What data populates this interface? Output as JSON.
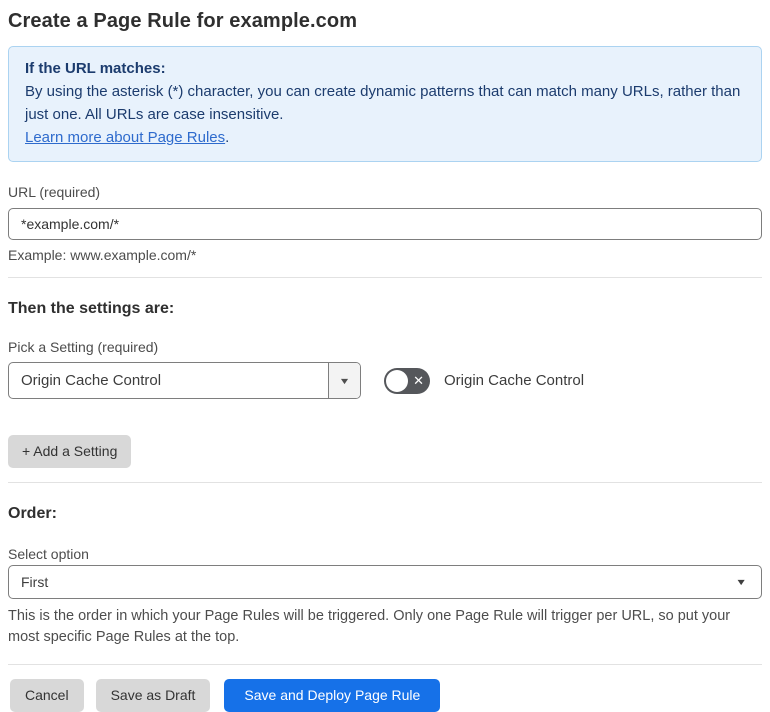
{
  "page": {
    "title": "Create a Page Rule for example.com"
  },
  "info_box": {
    "heading": "If the URL matches:",
    "body": "By using the asterisk (*) character, you can create dynamic patterns that can match many URLs, rather than just one. All URLs are case insensitive.",
    "link_label": "Learn more about Page Rules",
    "link_suffix": "."
  },
  "url_section": {
    "label": "URL (required)",
    "value": "*example.com/*",
    "helper": "Example: www.example.com/*"
  },
  "settings_section": {
    "heading": "Then the settings are:",
    "picker_label": "Pick a Setting (required)",
    "selected_setting": "Origin Cache Control",
    "toggle_label": "Origin Cache Control",
    "toggle_state": "off",
    "add_button_label": "+ Add a Setting"
  },
  "order_section": {
    "heading": "Order:",
    "label": "Select option",
    "selected_option": "First",
    "helper": "This is the order in which your Page Rules will be triggered. Only one Page Rule will trigger per URL, so put your most specific Page Rules at the top."
  },
  "footer": {
    "cancel_label": "Cancel",
    "save_draft_label": "Save as Draft",
    "save_deploy_label": "Save and Deploy Page Rule"
  },
  "icons": {
    "caret_down": "▼",
    "toggle_off_x": "✕"
  },
  "colors": {
    "accent_blue": "#1671e8",
    "info_bg": "#e8f2fc",
    "info_border": "#abd3f1",
    "info_text": "#1c3c6e",
    "link_blue": "#2e6bcd",
    "toggle_off_bg": "#55575b",
    "button_gray": "#d8d8d8"
  }
}
